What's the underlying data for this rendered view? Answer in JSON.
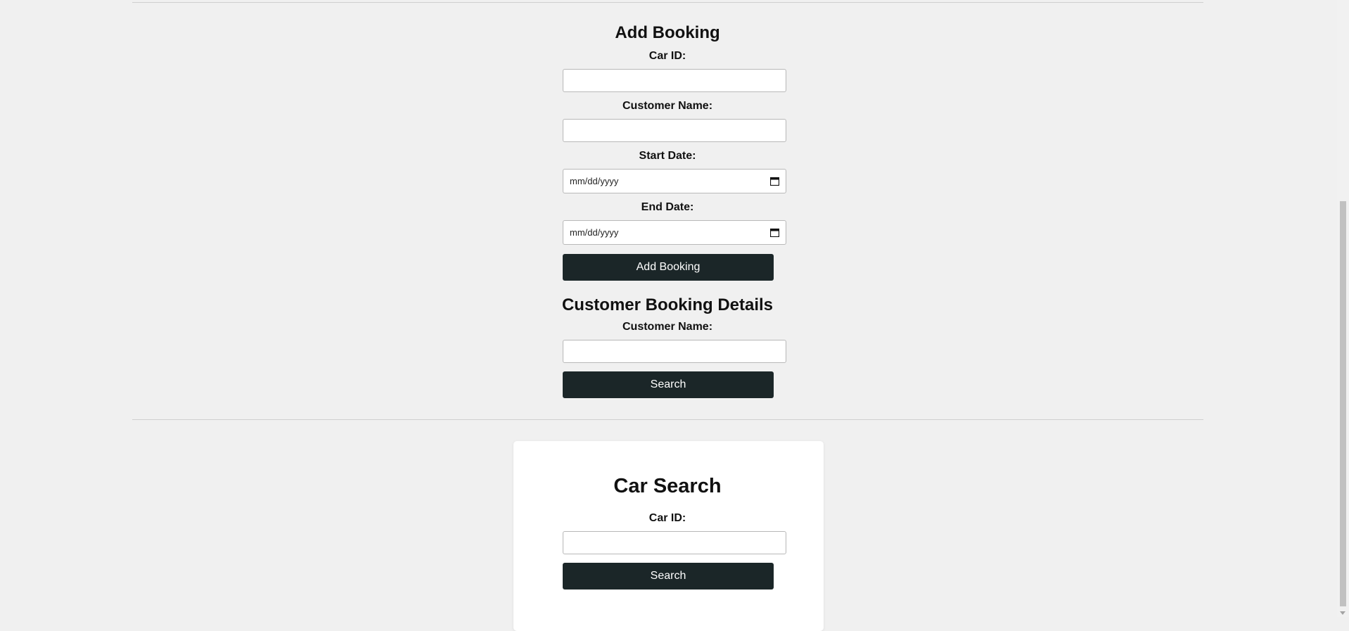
{
  "add_booking": {
    "title": "Add Booking",
    "car_id_label": "Car ID:",
    "car_id_value": "",
    "customer_name_label": "Customer Name:",
    "customer_name_value": "",
    "start_date_label": "Start Date:",
    "start_date_placeholder": "mm/dd/yyyy",
    "end_date_label": "End Date:",
    "end_date_placeholder": "mm/dd/yyyy",
    "submit_label": "Add Booking"
  },
  "customer_booking_details": {
    "title": "Customer Booking Details",
    "customer_name_label": "Customer Name:",
    "customer_name_value": "",
    "search_label": "Search"
  },
  "car_search": {
    "title": "Car Search",
    "car_id_label": "Car ID:",
    "car_id_value": "",
    "search_label": "Search"
  },
  "icons": {
    "date_picker": "calendar-icon"
  },
  "colors": {
    "page_background": "#f0f0f0",
    "button_background": "#1b2628",
    "button_text": "#ffffff",
    "card_background": "#ffffff"
  }
}
